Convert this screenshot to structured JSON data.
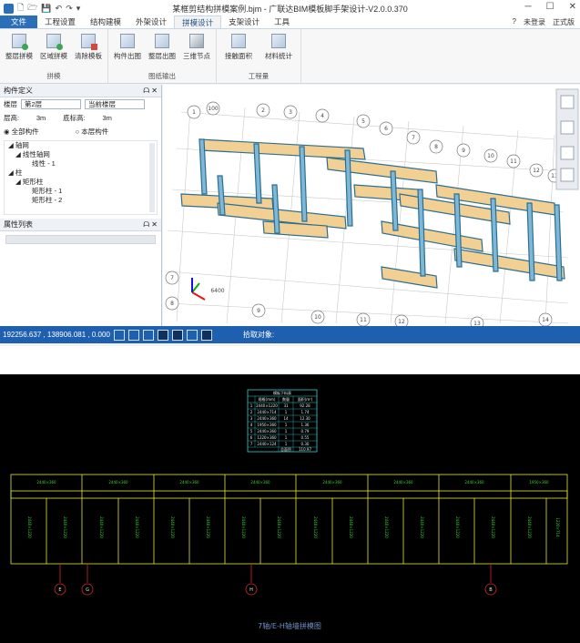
{
  "titlebar": {
    "title": "某框剪结构拼模案例.bjm - 广联达BIM模板脚手架设计-V2.0.0.370",
    "window_controls": [
      "─",
      "☐",
      "✕"
    ]
  },
  "tabs": [
    {
      "label": "文件",
      "state": "file"
    },
    {
      "label": "工程设置",
      "state": "normal"
    },
    {
      "label": "结构建模",
      "state": "normal"
    },
    {
      "label": "外架设计",
      "state": "normal"
    },
    {
      "label": "拼模设计",
      "state": "active"
    },
    {
      "label": "支架设计",
      "state": "normal"
    },
    {
      "label": "工具",
      "state": "normal"
    }
  ],
  "tab_right": {
    "help": "?",
    "login": "未登录",
    "edition": "正式版"
  },
  "ribbon": {
    "groups": [
      {
        "label": "拼模",
        "buttons": [
          "整层拼模",
          "区域拼模",
          "清除模板"
        ]
      },
      {
        "label": "图纸输出",
        "buttons": [
          "构件出图",
          "整层出图",
          "三维节点"
        ]
      },
      {
        "label": "工程量",
        "buttons": [
          "接触面积",
          "材料统计"
        ]
      }
    ]
  },
  "left_panel": {
    "title": "构件定义",
    "floor_label": "楼层",
    "floor_value": "第2层",
    "scope_value": "当前楼层",
    "height_label": "层高:",
    "height_value": "3m",
    "base_label": "底标高:",
    "base_value": "3m",
    "radio_all": "全部构件",
    "radio_floor": "本层构件",
    "tree": [
      {
        "label": "轴网",
        "level": 1
      },
      {
        "label": "线性轴网",
        "level": 2
      },
      {
        "label": "线性 - 1",
        "level": 3
      },
      {
        "label": "柱",
        "level": 1
      },
      {
        "label": "矩形柱",
        "level": 2
      },
      {
        "label": "矩形柱 - 1",
        "level": 3
      },
      {
        "label": "矩形柱 - 2",
        "level": 3
      }
    ]
  },
  "props_panel": {
    "title": "属性列表"
  },
  "statusbar": {
    "coords": "192256.637 , 138906.081 , 0.000",
    "pick_label": "拾取对象:"
  },
  "viewport": {
    "axis_labels_top": [
      "1",
      "100",
      "2",
      "3",
      "4",
      "5",
      "6",
      "7",
      "8",
      "9",
      "10",
      "11",
      "12",
      "13"
    ],
    "axis_labels_bottom": [
      "7",
      "8",
      "9",
      "10",
      "11",
      "12",
      "13",
      "14"
    ],
    "dim_text": "6400"
  },
  "drawing": {
    "table": {
      "title": "模板下料表",
      "headers": [
        "",
        "规格(mm)",
        "数量",
        "面积(m²)"
      ],
      "rows": [
        [
          "1",
          "2440×1220",
          "31",
          "92.28"
        ],
        [
          "2",
          "2440×714",
          "1",
          "1.74"
        ],
        [
          "3",
          "2440×360",
          "14",
          "12.30"
        ],
        [
          "4",
          "1950×360",
          "1",
          "1.36"
        ],
        [
          "5",
          "2440×360",
          "1",
          "0.79"
        ],
        [
          "6",
          "1220×360",
          "1",
          "0.55"
        ],
        [
          "7",
          "2440×124",
          "1",
          "0.30"
        ]
      ],
      "total_label": "总面积",
      "total_value": "110.97"
    },
    "top_panels": [
      "2440×360",
      "2440×360",
      "2440×360",
      "2440×360",
      "2440×360",
      "2440×360",
      "2440×360",
      "1950×360"
    ],
    "vertical_labels": [
      "2440×1220",
      "2440×1220",
      "2440×1220",
      "2440×1220",
      "2440×1220",
      "2440×1220",
      "2440×1220",
      "2440×1220",
      "2440×1220",
      "2440×1220",
      "2440×1220",
      "2440×1220",
      "2440×1220",
      "2440×1220",
      "2440×1220",
      "1220×714"
    ],
    "axis_circles": [
      "E",
      "G",
      "H",
      "B"
    ],
    "caption": "7轴/E-H轴墙拼模图"
  }
}
